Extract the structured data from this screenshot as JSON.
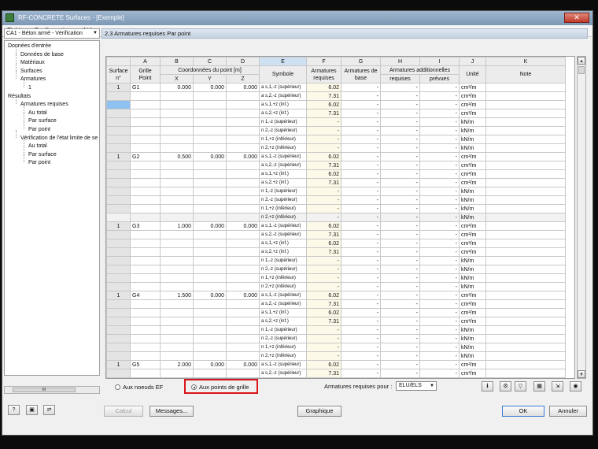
{
  "window": {
    "title": "RF-CONCRETE Surfaces - [Exemple]",
    "close_glyph": "✕"
  },
  "menu": [
    "Fichier",
    "Configurations",
    "Aide"
  ],
  "case_selector": {
    "value": "CA1 - Béton armé - Vérification"
  },
  "section_title": "2.3 Armatures requises Par point",
  "nav": {
    "items": [
      {
        "label": "Données d'entrée",
        "level": 0
      },
      {
        "label": "Données de base",
        "level": 1
      },
      {
        "label": "Matériaux",
        "level": 1
      },
      {
        "label": "Surfaces",
        "level": 1
      },
      {
        "label": "Armatures",
        "level": 1
      },
      {
        "label": "1",
        "level": 2
      },
      {
        "label": "Résultats",
        "level": 0
      },
      {
        "label": "Armatures requises",
        "level": 1
      },
      {
        "label": "Au total",
        "level": 2
      },
      {
        "label": "Par surface",
        "level": 2
      },
      {
        "label": "Par point",
        "level": 2
      },
      {
        "label": "Vérification de l'état limite de se",
        "level": 1
      },
      {
        "label": "Au total",
        "level": 2
      },
      {
        "label": "Par surface",
        "level": 2
      },
      {
        "label": "Par point",
        "level": 2
      }
    ],
    "scroll_thumb": "III"
  },
  "table": {
    "letters": [
      "A",
      "B",
      "C",
      "D",
      "E",
      "F",
      "G",
      "H",
      "I",
      "J",
      "K"
    ],
    "headers": {
      "surface": "Surface n°",
      "grille": "Grille Point",
      "coord": "Coordonnées du point [m]",
      "x": "X",
      "y": "Y",
      "z": "Z",
      "symbole": "Symbole",
      "req": "Armatures requises",
      "base": "Armatures de base",
      "add": "Armatures additionnelles",
      "add_req": "requises",
      "add_prev": "prévues",
      "unit": "Unité",
      "note": "Note"
    },
    "groups": [
      {
        "surface": "1",
        "point": "G1",
        "x": "0.000",
        "y": "0.000",
        "z": "0.000",
        "req": [
          "6.02",
          "7.31",
          "6.02",
          "7.31",
          "-",
          "-",
          "-",
          "-"
        ]
      },
      {
        "surface": "1",
        "point": "G2",
        "x": "0.500",
        "y": "0.000",
        "z": "0.000",
        "req": [
          "6.02",
          "7.31",
          "6.02",
          "7.31",
          "-",
          "-",
          "-",
          "-"
        ]
      },
      {
        "surface": "1",
        "point": "G3",
        "x": "1.000",
        "y": "0.000",
        "z": "0.000",
        "req": [
          "6.02",
          "7.31",
          "6.02",
          "7.31",
          "-",
          "-",
          "-",
          "-"
        ]
      },
      {
        "surface": "1",
        "point": "G4",
        "x": "1.500",
        "y": "0.000",
        "z": "0.000",
        "req": [
          "6.02",
          "7.31",
          "6.02",
          "7.31",
          "-",
          "-",
          "-",
          "-"
        ]
      },
      {
        "surface": "1",
        "point": "G5",
        "x": "2.000",
        "y": "0.000",
        "z": "0.000",
        "req": [
          "6.02",
          "7.31"
        ]
      }
    ],
    "symbols": [
      "a s,1,-z (supérieur)",
      "a s,2,-z (supérieur)",
      "a s,1,+z (inf.)",
      "a s,2,+z (inf.)",
      "n 1,-z (supérieur)",
      "n 2,-z (supérieur)",
      "n 1,+z (inférieur)",
      "n 2,+z (inférieur)"
    ],
    "units": [
      "cm²/m",
      "cm²/m",
      "cm²/m",
      "cm²/m",
      "kN/m",
      "kN/m",
      "kN/m",
      "kN/m"
    ],
    "dash": "-"
  },
  "radios": {
    "nodes": {
      "label": "Aux noeuds EF",
      "selected": false
    },
    "grid": {
      "label": "Aux points de grille",
      "selected": true
    }
  },
  "req_filter": {
    "label": "Armatures requises pour :",
    "value": "ELU/ELS"
  },
  "toolbar_icons": [
    "info-icon",
    "table-settings-icon",
    "filter-icon",
    "color-scale-icon",
    "export-icon",
    "view-icon"
  ],
  "footer": {
    "calcul": "Calcul",
    "messages": "Messages...",
    "graphique": "Graphique",
    "ok": "OK",
    "annuler": "Annuler"
  }
}
